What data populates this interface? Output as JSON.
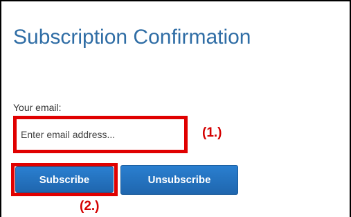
{
  "page": {
    "title": "Subscription Confirmation"
  },
  "form": {
    "email_label": "Your email:",
    "email_placeholder": "Enter email address...",
    "email_value": ""
  },
  "buttons": {
    "subscribe_label": "Subscribe",
    "unsubscribe_label": "Unsubscribe"
  },
  "annotations": {
    "callout_1": "(1.)",
    "callout_2": "(2.)",
    "highlight_color": "#e00000",
    "callout_color": "#d40000"
  },
  "colors": {
    "title": "#2f6da5",
    "button_bg": "#2273c1"
  }
}
